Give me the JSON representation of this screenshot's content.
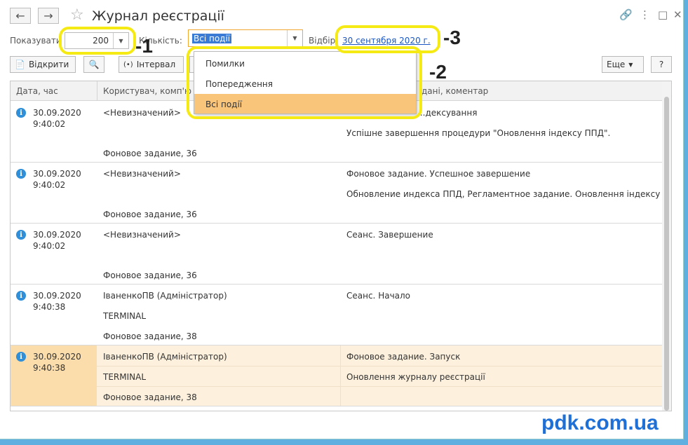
{
  "window": {
    "title": "Журнал реєстрації"
  },
  "filters": {
    "show_label": "Показувати",
    "count_value": "200",
    "importance_label": "Кількість:",
    "importance_value": "Всі події",
    "selection_label": "Відбір:",
    "selection_date": "30 сентября 2020 г."
  },
  "toolbar": {
    "open_label": "Відкрити",
    "interval_label": "Інтервал",
    "more_label": "Еще",
    "help_label": "?"
  },
  "grid": {
    "columns": [
      "Дата, час",
      "Користувач, комп'ютер",
      "Дані, коментар"
    ],
    "header_user_partial": "Користувач, комп'ю",
    "header_data_partial": "дані, коментар",
    "rows": [
      {
        "date": "30.09.2020",
        "time": "9:40:02",
        "user": "<Невизначений>",
        "computer": "",
        "app": "Фоновое задание, 36",
        "event": "...дексування",
        "comment": "Успішне завершення процедури \"Оновлення індексу ППД\"."
      },
      {
        "date": "30.09.2020",
        "time": "9:40:02",
        "user": "<Невизначений>",
        "computer": "",
        "app": "Фоновое задание, 36",
        "event": "Фоновое задание. Успешное завершение",
        "comment": "Обновление индекса ППД, Регламентное задание. Оновлення індексу ..."
      },
      {
        "date": "30.09.2020",
        "time": "9:40:02",
        "user": "<Невизначений>",
        "computer": "",
        "app": "Фоновое задание, 36",
        "event": "Сеанс. Завершение",
        "comment": ""
      },
      {
        "date": "30.09.2020",
        "time": "9:40:38",
        "user": "ІваненкоПВ (Адміністратор)",
        "computer": "TERMINAL",
        "app": "Фоновое задание, 38",
        "event": "Сеанс. Начало",
        "comment": ""
      },
      {
        "date": "30.09.2020",
        "time": "9:40:38",
        "user": "ІваненкоПВ (Адміністратор)",
        "computer": "TERMINAL",
        "app": "Фоновое задание, 38",
        "event": "Фоновое задание. Запуск",
        "comment": "Оновлення журналу реєстрації"
      }
    ]
  },
  "dropdown": {
    "items": [
      "Помилки",
      "Попередження",
      "Всі події"
    ],
    "selected": "Всі події"
  },
  "annotations": {
    "one": "-1",
    "two": "-2",
    "three": "-3"
  },
  "watermark": "pdk.com.ua",
  "colors": {
    "highlight": "#f6ea14",
    "selected_row": "#fdf0dc",
    "link": "#1a57c4",
    "dropdown_selected": "#f9c57a"
  }
}
